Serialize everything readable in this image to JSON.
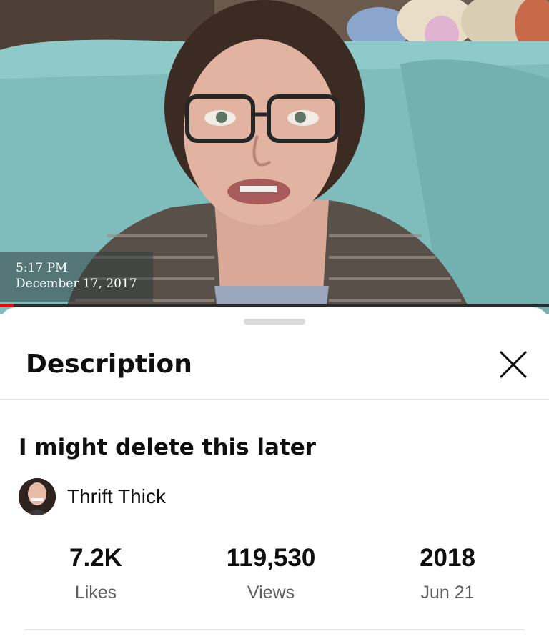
{
  "video": {
    "time": "5:17 PM",
    "date": "December 17, 2017",
    "progress_fraction": 0.025
  },
  "sheet": {
    "title": "Description",
    "close_icon": "close-icon"
  },
  "details": {
    "title": "I might delete this later",
    "channel_name": "Thrift Thick"
  },
  "stats": [
    {
      "value": "7.2K",
      "label": "Likes"
    },
    {
      "value": "119,530",
      "label": "Views"
    },
    {
      "value": "2018",
      "label": "Jun 21"
    }
  ],
  "colors": {
    "progress": "#ff0000",
    "couch": "#7fbcbc"
  }
}
